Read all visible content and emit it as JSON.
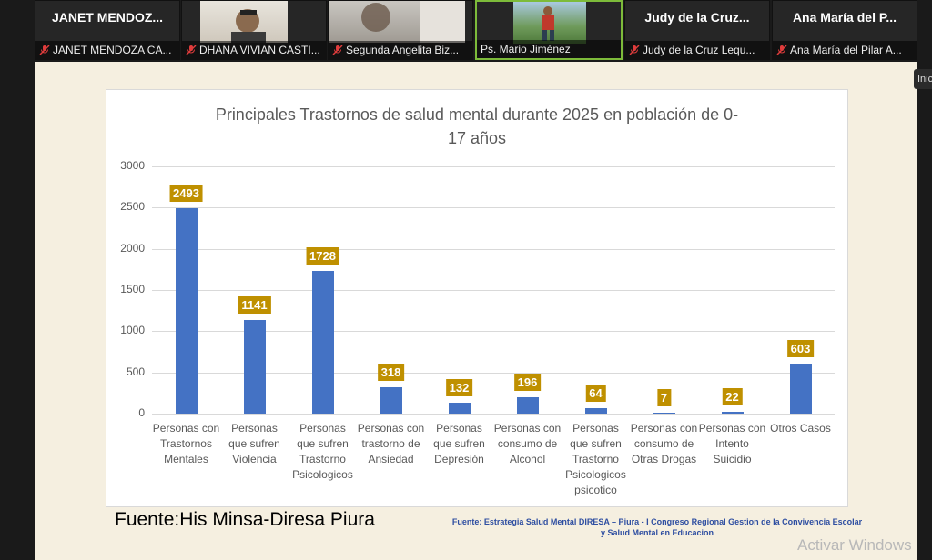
{
  "participants": [
    {
      "big": "JANET MENDOZ...",
      "name": "JANET MENDOZA CA...",
      "muted": true,
      "video": false
    },
    {
      "big": "",
      "name": "DHANA VIVIAN CASTI...",
      "muted": true,
      "video": true
    },
    {
      "big": "",
      "name": "Segunda Angelita Biz...",
      "muted": true,
      "video": true
    },
    {
      "big": "",
      "name": "Ps. Mario Jiménez",
      "muted": false,
      "video": true,
      "active": true
    },
    {
      "big": "Judy de la Cruz...",
      "name": "Judy de la Cruz Lequ...",
      "muted": true,
      "video": false
    },
    {
      "big": "Ana María del P...",
      "name": "Ana María del Pilar A...",
      "muted": true,
      "video": false
    }
  ],
  "side_tab": "Inic",
  "slide": {
    "source_main": "Fuente:His Minsa-Diresa Piura",
    "source_note_line1": "Fuente: Estrategia Salud Mental DIRESA – Piura - I Congreso Regional Gestion de la Convivencia Escolar",
    "source_note_line2": "y Salud Mental en Educacion"
  },
  "chart_data": {
    "type": "bar",
    "title_line1": "Principales Trastornos de salud mental  durante 2025 en población de 0-",
    "title_line2": "17 años",
    "categories": [
      [
        "Personas con",
        "Trastornos",
        "Mentales"
      ],
      [
        "Personas",
        "que sufren",
        "Violencia"
      ],
      [
        "Personas",
        "que sufren",
        "Trastorno",
        "Psicologicos"
      ],
      [
        "Personas con",
        "trastorno de",
        "Ansiedad"
      ],
      [
        "Personas",
        "que sufren",
        "Depresión"
      ],
      [
        "Personas con",
        "consumo de",
        "Alcohol"
      ],
      [
        "Personas",
        "que sufren",
        "Trastorno",
        "Psicologicos",
        "psicotico"
      ],
      [
        "Personas con",
        "consumo de",
        "Otras Drogas"
      ],
      [
        "Personas con",
        "Intento",
        "Suicidio"
      ],
      [
        "Otros Casos"
      ]
    ],
    "values": [
      2493,
      1141,
      1728,
      318,
      132,
      196,
      64,
      7,
      22,
      603
    ],
    "ylim": [
      0,
      3000
    ],
    "yticks": [
      0,
      500,
      1000,
      1500,
      2000,
      2500,
      3000
    ],
    "grid": true,
    "bar_color": "#4472c4",
    "label_color": "#bf9000"
  },
  "watermark": "Activar Windows"
}
